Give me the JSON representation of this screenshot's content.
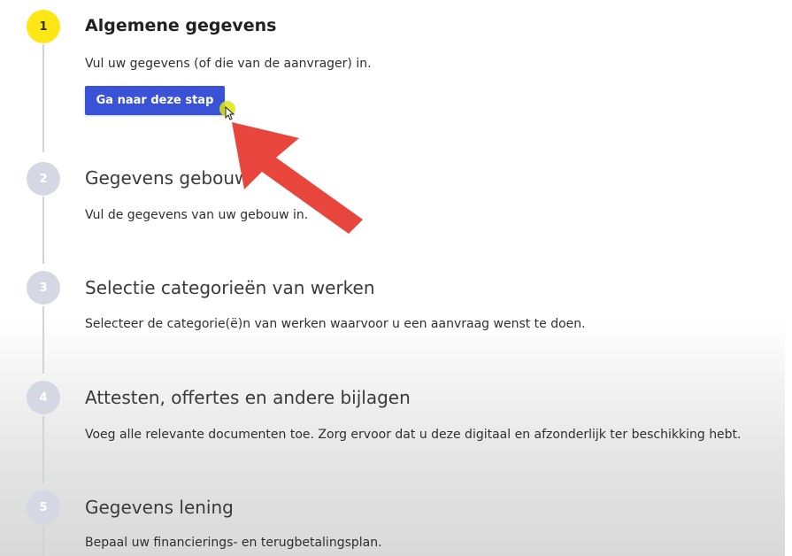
{
  "steps": [
    {
      "number": "1",
      "title": "Algemene gegevens",
      "description": "Vul uw gegevens (of die van de aanvrager) in.",
      "button_label": "Ga naar deze stap"
    },
    {
      "number": "2",
      "title": "Gegevens gebouw",
      "description": "Vul de gegevens van uw gebouw in."
    },
    {
      "number": "3",
      "title": "Selectie categorieën van werken",
      "description": "Selecteer de categorie(ë)n van werken waarvoor u een aanvraag wenst te doen."
    },
    {
      "number": "4",
      "title": "Attesten, offertes en andere bijlagen",
      "description": "Voeg alle relevante documenten toe. Zorg ervoor dat u deze digitaal en afzonderlijk ter beschikking hebt."
    },
    {
      "number": "5",
      "title": "Gegevens lening",
      "description": "Bepaal uw financierings- en terugbetalingsplan."
    }
  ],
  "colors": {
    "active_step": "#ffe615",
    "inactive_step": "#d3d8e2",
    "button": "#3a52d6",
    "annotation_arrow": "#e8453c"
  },
  "icons": {
    "annotation": "red-arrow-icon",
    "pointer": "mouse-cursor-icon"
  }
}
